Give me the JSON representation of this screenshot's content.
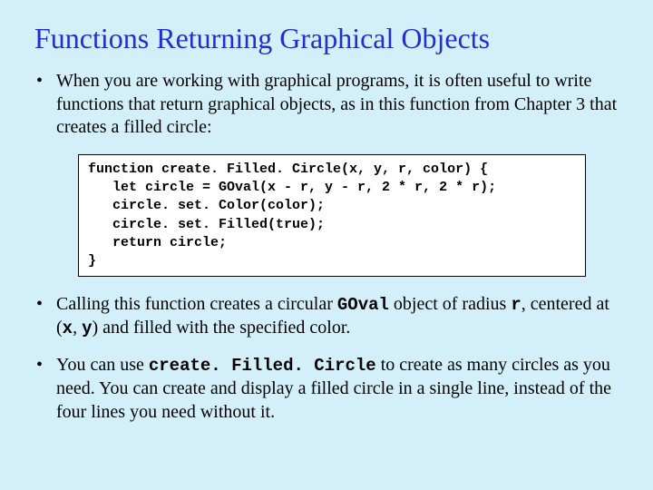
{
  "title": "Functions Returning Graphical Objects",
  "bullets": {
    "b1": "When you are working with graphical programs, it is often useful to write functions that return graphical objects, as in this function from Chapter 3 that creates a filled circle:",
    "b2a": "Calling this function creates a circular ",
    "b2b": " object of radius ",
    "b2c": ", centered at (",
    "b2d": ", ",
    "b2e": ") and filled with the specified color.",
    "b3a": "You can use ",
    "b3b": " to create as many circles as you need.  You can create and display a filled circle in a single line, instead of the four lines you need without it."
  },
  "inline": {
    "goval": "GOval",
    "r": "r",
    "x": "x",
    "y": "y",
    "cfc": "create. Filled. Circle"
  },
  "code": {
    "l1": "function create. Filled. Circle(x, y, r, color) {",
    "l2": "   let circle = GOval(x - r, y - r, 2 * r, 2 * r);",
    "l3": "   circle. set. Color(color);",
    "l4": "   circle. set. Filled(true);",
    "l5": "   return circle;",
    "l6": "}"
  }
}
